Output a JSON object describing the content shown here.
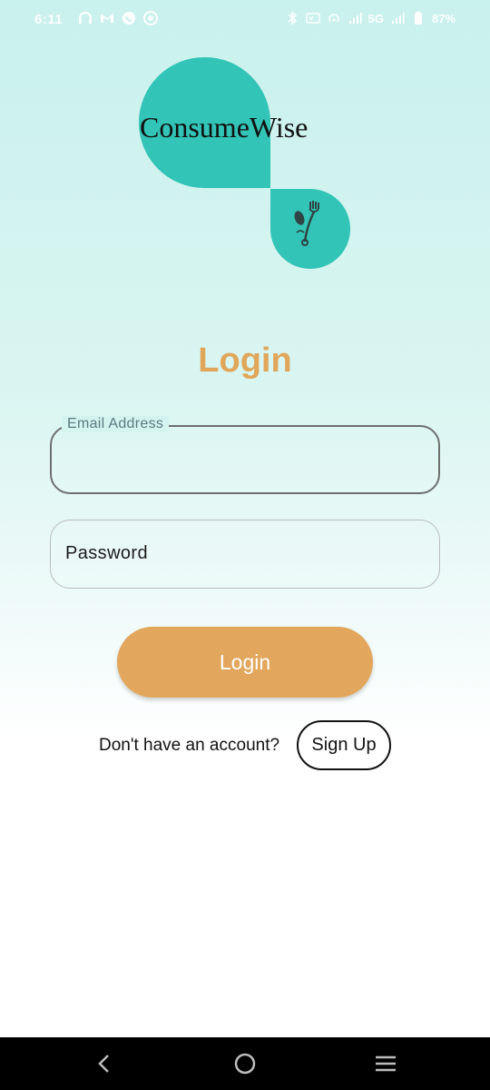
{
  "status_bar": {
    "time": "6:11",
    "battery": "87%",
    "network": "5G",
    "left_icons": [
      "headset-icon",
      "gmail-icon",
      "whatsapp-icon",
      "chrome-icon"
    ],
    "right_icons": [
      "bluetooth-icon",
      "volte-icon",
      "hotspot-icon",
      "signal-icon",
      "signal-icon",
      "battery-icon"
    ]
  },
  "logo": {
    "brand_name": "ConsumeWise",
    "icon": "spoon-fork-icon",
    "color": "#32c4b6"
  },
  "login": {
    "title": "Login",
    "email_label": "Email Address",
    "email_value": "",
    "password_placeholder": "Password",
    "password_value": "",
    "submit_label": "Login",
    "accent_color": "#e2a75d"
  },
  "signup": {
    "prompt": "Don't have an account?",
    "button_label": "Sign Up"
  },
  "nav_bar": {
    "back": "back-icon",
    "home": "home-icon",
    "menu": "menu-icon"
  }
}
